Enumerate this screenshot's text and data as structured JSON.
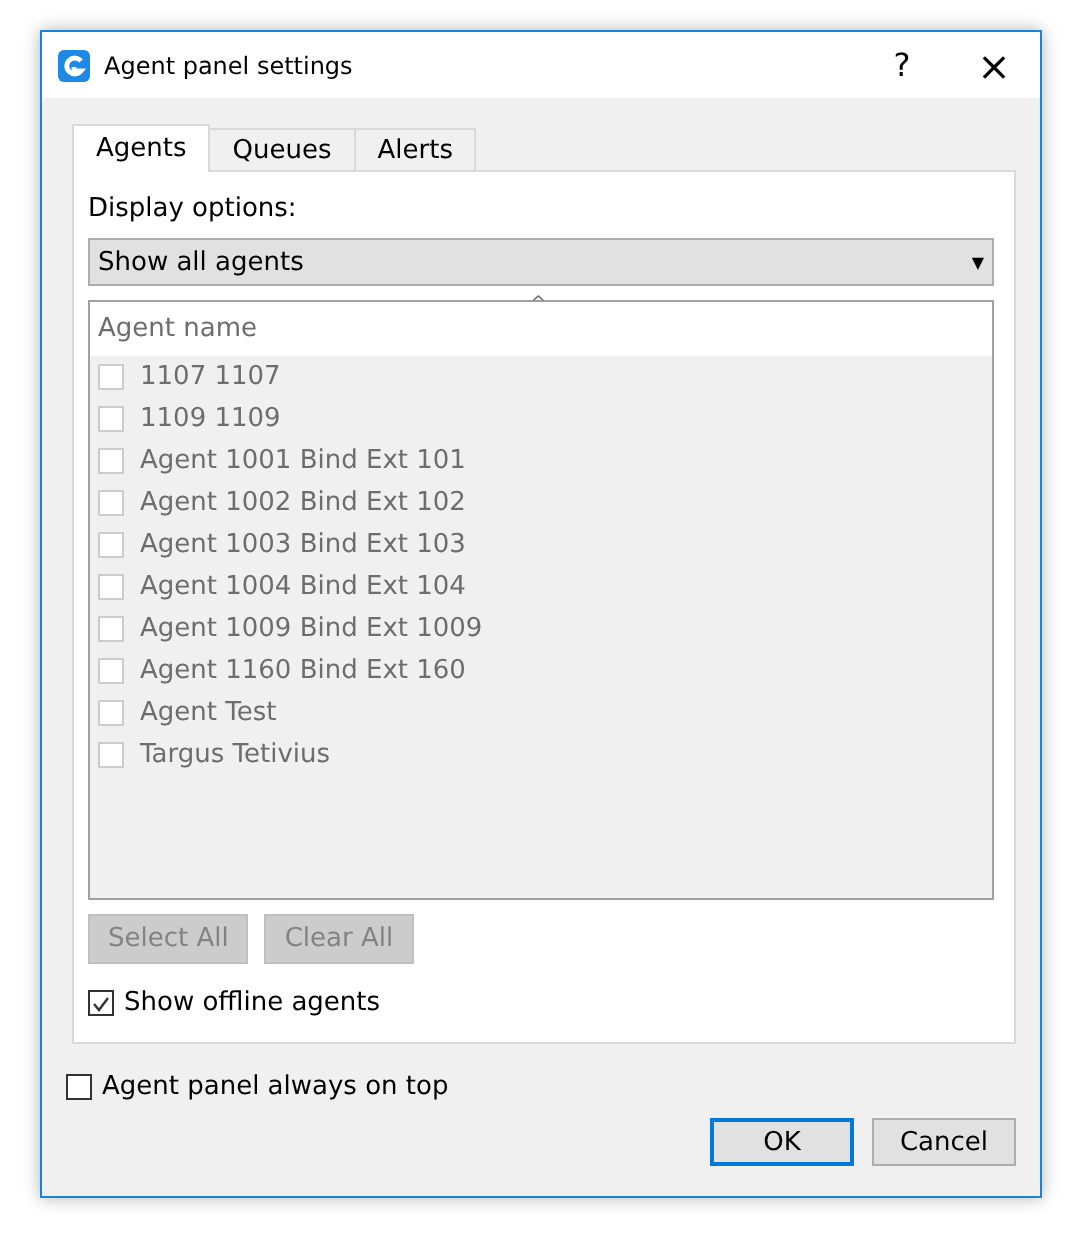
{
  "window": {
    "title": "Agent panel settings",
    "help": "?",
    "close": "×"
  },
  "tabs": [
    {
      "label": "Agents",
      "selected": true
    },
    {
      "label": "Queues",
      "selected": false
    },
    {
      "label": "Alerts",
      "selected": false
    }
  ],
  "display_options": {
    "label": "Display options:",
    "value": "Show all agents",
    "arrow": "▼"
  },
  "agent_list": {
    "column": "Agent name",
    "sort": "^",
    "disabled": true,
    "items": [
      {
        "name": "1107 1107",
        "checked": false
      },
      {
        "name": "1109 1109",
        "checked": false
      },
      {
        "name": "Agent 1001 Bind Ext 101",
        "checked": false
      },
      {
        "name": "Agent 1002 Bind Ext 102",
        "checked": false
      },
      {
        "name": "Agent 1003 Bind Ext 103",
        "checked": false
      },
      {
        "name": "Agent 1004 Bind Ext 104",
        "checked": false
      },
      {
        "name": "Agent 1009 Bind Ext 1009",
        "checked": false
      },
      {
        "name": "Agent 1160 Bind Ext 160",
        "checked": false
      },
      {
        "name": "Agent Test",
        "checked": false
      },
      {
        "name": "Targus Tetivius",
        "checked": false
      }
    ]
  },
  "list_buttons": [
    {
      "label": "Select All",
      "disabled": true
    },
    {
      "label": "Clear All",
      "disabled": true
    }
  ],
  "show_offline": {
    "label": "Show offline agents",
    "checked": true
  },
  "always_on_top": {
    "label": "Agent panel always on top",
    "checked": false
  },
  "buttons": [
    {
      "label": "OK",
      "default": true
    },
    {
      "label": "Cancel",
      "default": false
    }
  ]
}
